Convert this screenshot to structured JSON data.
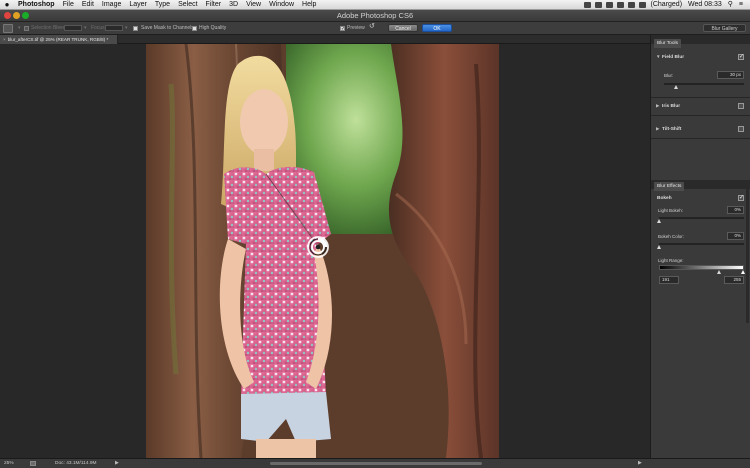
{
  "menubar": {
    "app": "Photoshop",
    "items": [
      "File",
      "Edit",
      "Image",
      "Layer",
      "Type",
      "Select",
      "Filter",
      "3D",
      "View",
      "Window",
      "Help"
    ],
    "battery": "(Charged)",
    "clock": "Wed 08:33"
  },
  "window": {
    "title": "Adobe Photoshop CS6"
  },
  "options": {
    "selection_bleed_label": "Selection Bleed:",
    "focus_label": "Focus:",
    "save_mask_label": "Save Mask to Channels",
    "high_quality_label": "High Quality",
    "preview_label": "Preview",
    "cancel_label": "Cancel",
    "ok_label": "OK",
    "gallery_label": "Blur Gallery"
  },
  "document": {
    "tab_title": "blur_afterCS.tif @ 25% (REAR TRUNK, RGB/8) *"
  },
  "blur_tools": {
    "tab_label": "Blur Tools",
    "field_blur": {
      "label": "Field Blur",
      "blur_label": "Blur:",
      "blur_value": "30 px",
      "blur_fraction": 0.15
    },
    "iris_blur": {
      "label": "Iris Blur"
    },
    "tilt_shift": {
      "label": "Tilt-Shift"
    }
  },
  "blur_effects": {
    "tab_label": "Blur Effects",
    "bokeh_label": "Bokeh",
    "light_bokeh_label": "Light Bokeh:",
    "light_bokeh_value": "0%",
    "bokeh_color_label": "Bokeh Color:",
    "bokeh_color_value": "0%",
    "light_range_label": "Light Range:",
    "light_range_low": "191",
    "light_range_high": "255"
  },
  "status": {
    "zoom": "25%",
    "doc_info": "Doc: 43.1M/114.9M"
  }
}
